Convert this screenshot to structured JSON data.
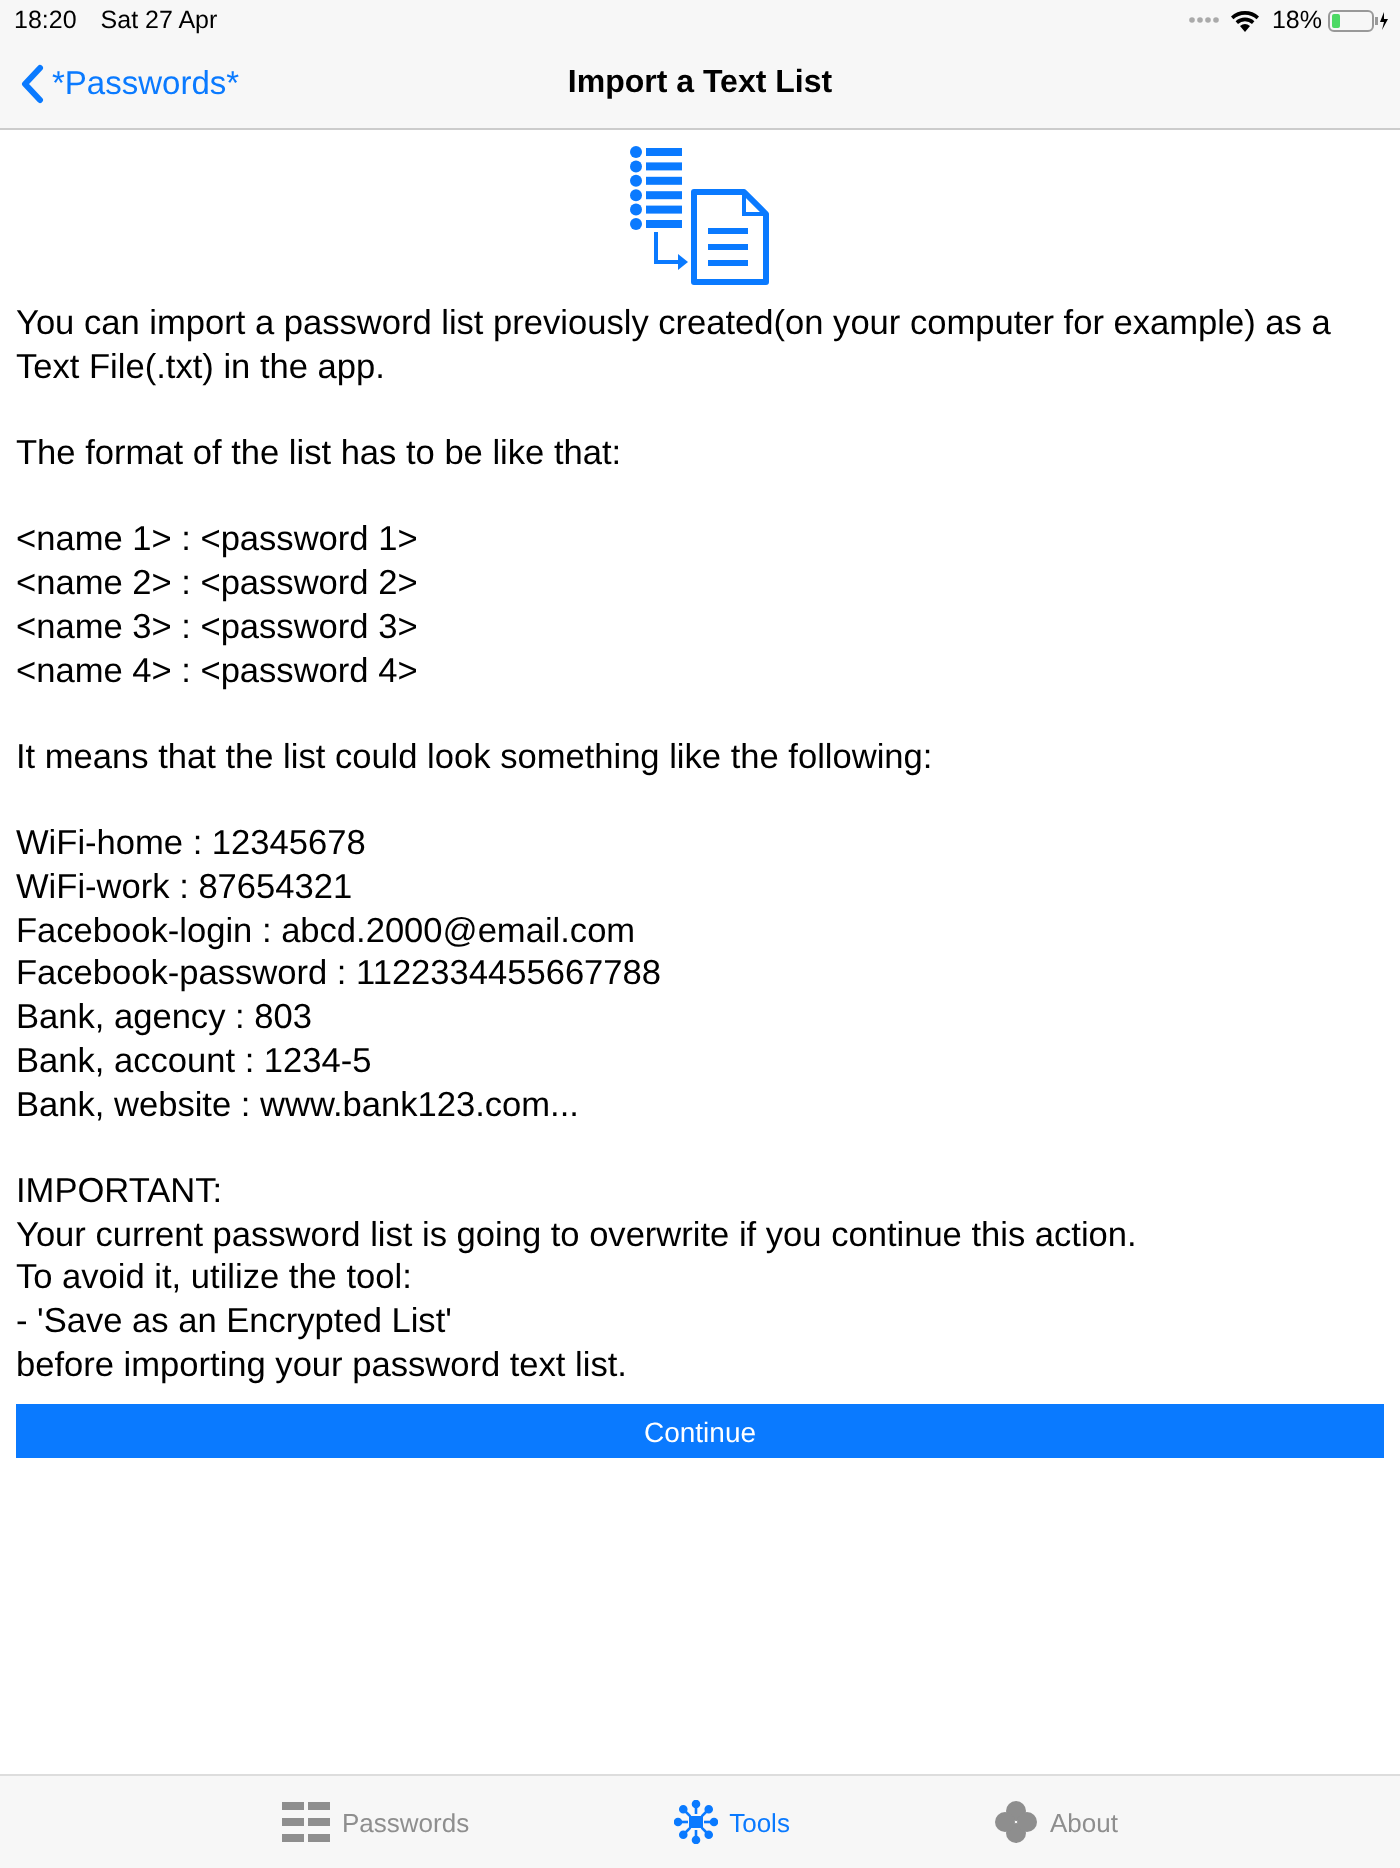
{
  "status_bar": {
    "time": "18:20",
    "date": "Sat 27 Apr",
    "battery": "18%"
  },
  "nav_bar": {
    "back": "*Passwords*",
    "title": "Import a Text List"
  },
  "paragraphs": [
    [
      "You can import a password list previously created(on your computer for example) as a Text File(.txt) in the app."
    ],
    [
      "The format of the list has to be like that:"
    ],
    [
      "<name 1> : <password 1>",
      "<name 2> : <password 2>",
      "<name 3> : <password 3>",
      "<name 4> : <password 4>"
    ],
    [
      "It means that the list could look something like the following:"
    ],
    [
      "WiFi-home : 12345678",
      "WiFi-work : 87654321",
      "Facebook-login : abcd.2000@email.com",
      "Facebook-password : 1122334455667788",
      "Bank, agency : 803",
      "Bank, account : 1234-5",
      "Bank, website : www.bank123.com..."
    ],
    [
      "IMPORTANT:",
      "Your current password list is going to overwrite if you continue this action.",
      "To avoid it, utilize the tool:",
      "- 'Save as an Encrypted List'",
      "before importing your password text list."
    ]
  ],
  "button": "Continue",
  "tabs": [
    {
      "kind": "grid",
      "label": "Passwords",
      "selected": false
    },
    {
      "kind": "hub",
      "label": "Tools",
      "selected": true
    },
    {
      "kind": "clover",
      "label": "About",
      "selected": false
    }
  ]
}
